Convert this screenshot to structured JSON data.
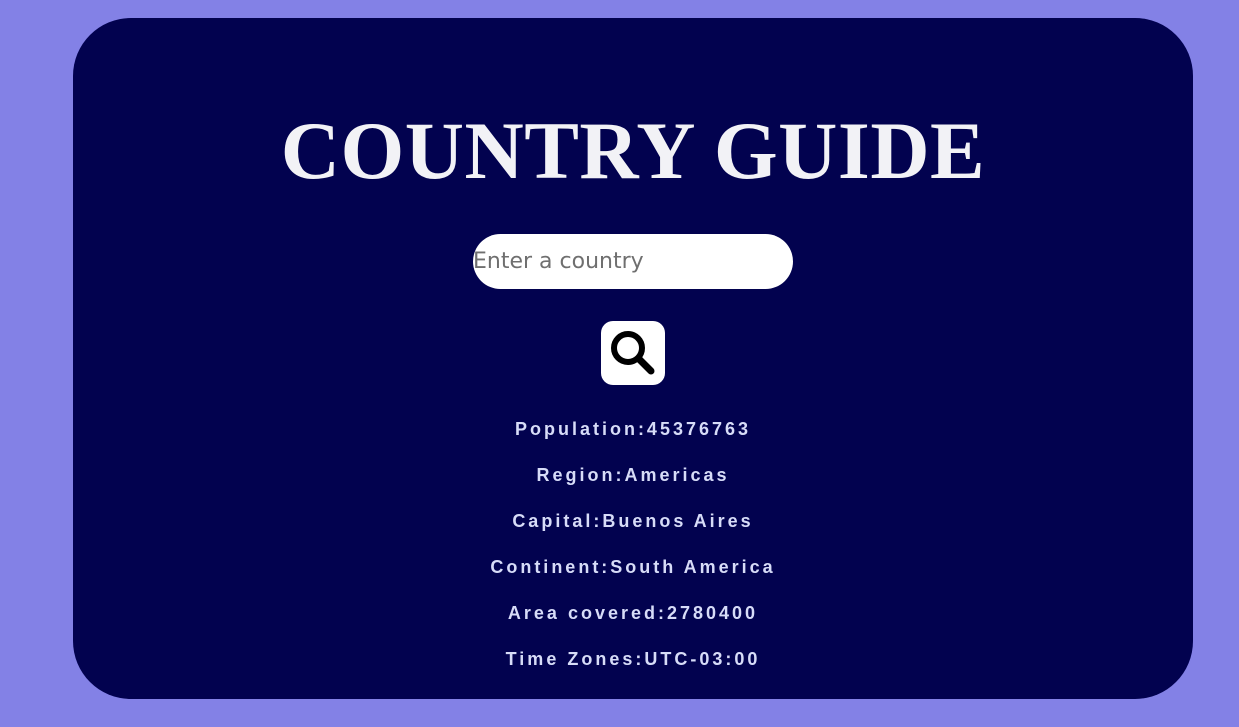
{
  "app": {
    "title": "COUNTRY GUIDE"
  },
  "search": {
    "placeholder": "Enter a country",
    "value": "",
    "button_icon": "search-icon"
  },
  "details": {
    "population": "Population:45376763",
    "region": "Region:Americas",
    "capital": "Capital:Buenos Aires",
    "continent": "Continent:South America",
    "area": "Area covered:2780400",
    "timezones": "Time Zones:UTC-03:00"
  },
  "colors": {
    "page_background": "#8381e6",
    "card_background": "#02024f",
    "title_text": "#f2f2f6",
    "info_text": "#d7dcf8"
  }
}
